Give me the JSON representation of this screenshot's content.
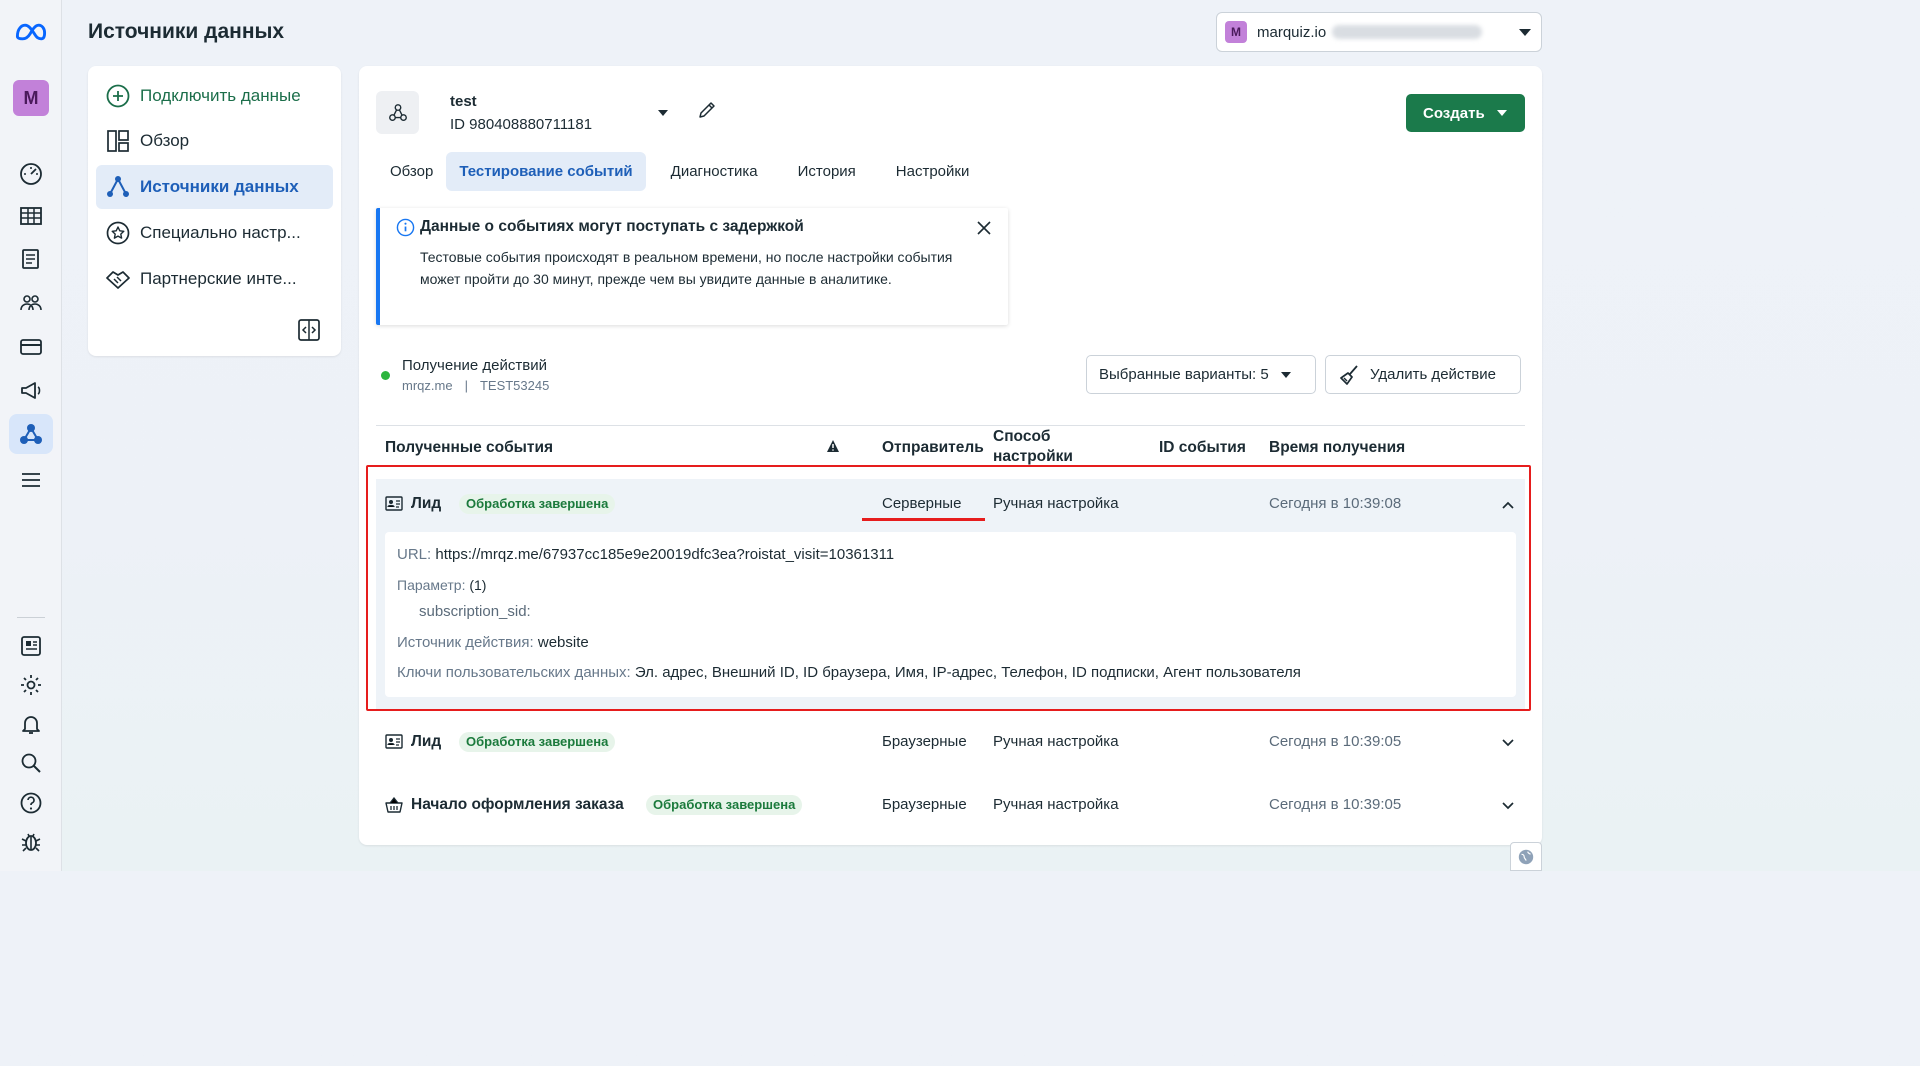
{
  "page": {
    "title": "Источники данных"
  },
  "account": {
    "badge": "M",
    "name": "marquiz.io"
  },
  "rail": {
    "avatar_letter": "M"
  },
  "nav": {
    "items": [
      {
        "label": "Подключить данные"
      },
      {
        "label": "Обзор"
      },
      {
        "label": "Источники данных"
      },
      {
        "label": "Специально настр..."
      },
      {
        "label": "Партнерские инте..."
      }
    ]
  },
  "datasource": {
    "name": "test",
    "id": "ID 980408880711181"
  },
  "create_label": "Создать",
  "tabs": [
    {
      "label": "Обзор"
    },
    {
      "label": "Тестирование событий"
    },
    {
      "label": "Диагностика"
    },
    {
      "label": "История"
    },
    {
      "label": "Настройки"
    }
  ],
  "notice": {
    "title": "Данные о событиях могут поступать с задержкой",
    "body": "Тестовые события происходят в реальном времени, но после настройки события может пройти до 30 минут, прежде чем вы увидите данные в аналитике."
  },
  "status": {
    "title": "Получение действий",
    "domain": "mrqz.me",
    "sep": "|",
    "code": "TEST53245",
    "color": "#2db53e"
  },
  "variants_label": "Выбранные варианты: 5",
  "delete_label": "Удалить действие",
  "table": {
    "headers": {
      "events": "Полученные события",
      "sender": "Отправитель",
      "method": "Способ настройки",
      "event_id": "ID события",
      "received": "Время получения"
    },
    "rows": [
      {
        "name": "Лид",
        "badge": "Обработка завершена",
        "sender": "Серверные",
        "method": "Ручная настройка",
        "time": "Сегодня в 10:39:08",
        "expanded": true
      },
      {
        "name": "Лид",
        "badge": "Обработка завершена",
        "sender": "Браузерные",
        "method": "Ручная настройка",
        "time": "Сегодня в 10:39:05",
        "expanded": false
      },
      {
        "name": "Начало оформления заказа",
        "badge": "Обработка завершена",
        "sender": "Браузерные",
        "method": "Ручная настройка",
        "time": "Сегодня в 10:39:05",
        "expanded": false
      }
    ],
    "details": {
      "url_key": "URL:",
      "url_value": "https://mrqz.me/67937cc185e9e20019dfc3ea?roistat_visit=10361311",
      "param_key": "Параметр:",
      "param_count": "(1)",
      "param_name": "subscription_sid:",
      "source_key": "Источник действия:",
      "source_value": "website",
      "keys_key": "Ключи пользовательских данных:",
      "keys_value": "Эл. адрес, Внешний ID, ID браузера, Имя, IP-адрес, Телефон, ID подписки, Агент пользователя"
    }
  },
  "colors": {
    "accent_blue": "#1e5fb8",
    "create_green": "#1b7a4b",
    "highlight_red": "#e61d1d",
    "badge_green": "#1b7a3c"
  }
}
